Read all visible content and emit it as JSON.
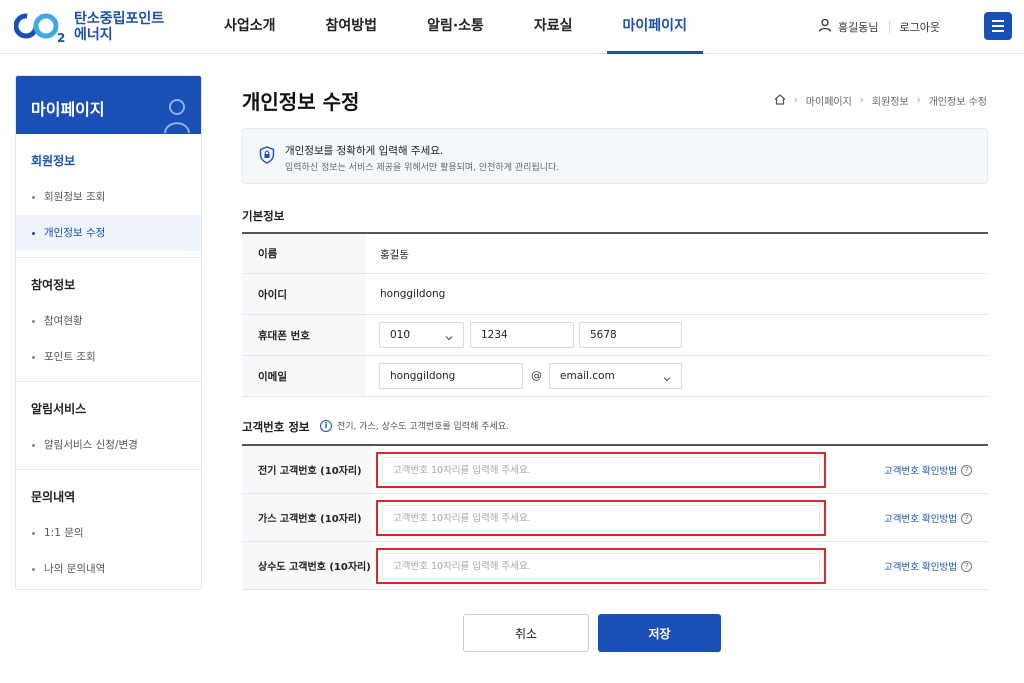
{
  "brand": {
    "mark": "CO2",
    "name_line1": "탄소중립포인트",
    "name_line2": "에너지"
  },
  "nav": {
    "items": [
      "사업소개",
      "참여방법",
      "알림·소통",
      "자료실",
      "마이페이지"
    ],
    "active_index": 4
  },
  "user": {
    "name": "홍길동님",
    "logout": "로그아웃"
  },
  "sidebar": {
    "title": "마이페이지",
    "groups": [
      {
        "title": "회원정보",
        "items": [
          "회원정보 조회",
          "개인정보 수정"
        ]
      },
      {
        "title": "참여정보",
        "items": [
          "참여현황",
          "포인트 조회"
        ]
      },
      {
        "title": "알림서비스",
        "items": [
          "알림서비스 신청/변경"
        ]
      },
      {
        "title": "문의내역",
        "items": [
          "1:1 문의",
          "나의 문의내역"
        ]
      }
    ]
  },
  "page": {
    "title": "개인정보 수정",
    "breadcrumb": [
      "마이페이지",
      "회원정보",
      "개인정보 수정"
    ]
  },
  "notice": {
    "line1": "개인정보를 정확하게 입력해 주세요.",
    "line2": "입력하신 정보는 서비스 제공을 위해서만 활용되며, 안전하게 관리됩니다."
  },
  "basic": {
    "section_title": "기본정보",
    "name_label": "이름",
    "name_value": "홍길동",
    "id_label": "아이디",
    "id_value": "honggildong",
    "phone_label": "휴대폰 번호",
    "phone1": "010",
    "phone2": "1234",
    "phone3": "5678",
    "email_label": "이메일",
    "email_local": "honggildong",
    "email_at": "@",
    "email_domain": "email.com"
  },
  "customer": {
    "section_title": "고객번호 정보",
    "info": "전기, 가스, 상수도 고객번호를 입력해 주세요.",
    "help": "고객번호 확인방법",
    "rows": [
      {
        "label": "전기 고객번호 (10자리)",
        "placeholder": "고객번호 10자리를 입력해 주세요.",
        "value": ""
      },
      {
        "label": "가스 고객번호 (10자리)",
        "placeholder": "고객번호 10자리를 입력해 주세요.",
        "value": ""
      },
      {
        "label": "상수도 고객번호 (10자리)",
        "placeholder": "고객번호 10자리를 입력해 주세요.",
        "value": ""
      }
    ]
  },
  "actions": {
    "cancel": "취소",
    "save": "저장"
  },
  "colors": {
    "brand": "#1a4fb5",
    "highlight": "#e0252b"
  }
}
